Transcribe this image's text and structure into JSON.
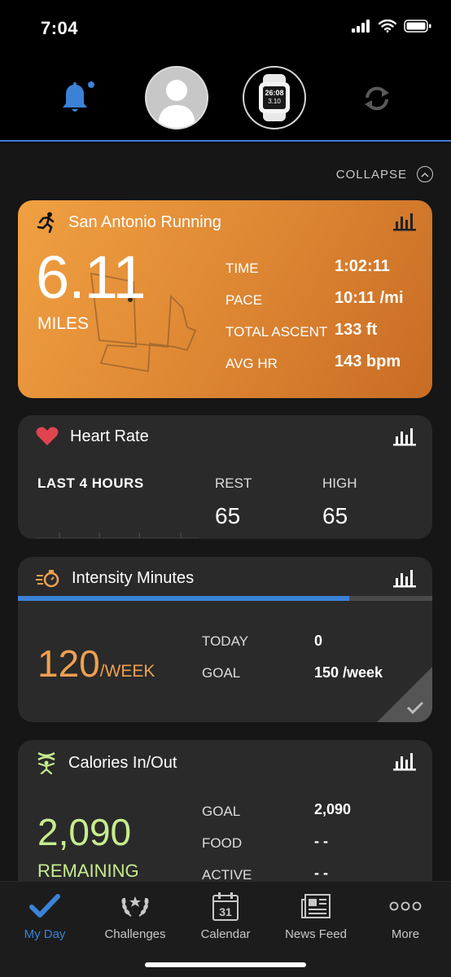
{
  "status_bar": {
    "time": "7:04"
  },
  "header": {
    "watch_face": {
      "line1": "26:08",
      "line2": "3.10"
    }
  },
  "collapse_label": "COLLAPSE",
  "activity_card": {
    "title": "San Antonio Running",
    "distance": "6.11",
    "distance_unit": "MILES",
    "stats": [
      {
        "label": "TIME",
        "value": "1:02:11"
      },
      {
        "label": "PACE",
        "value": "10:11 /mi"
      },
      {
        "label": "TOTAL ASCENT",
        "value": "133 ft"
      },
      {
        "label": "AVG HR",
        "value": "143 bpm"
      }
    ]
  },
  "heart_rate_card": {
    "title": "Heart Rate",
    "period": "LAST 4 HOURS",
    "rest_label": "REST",
    "rest_value": "65",
    "high_label": "HIGH",
    "high_value": "65"
  },
  "intensity_card": {
    "title": "Intensity Minutes",
    "progress_fraction": 0.8,
    "value": "120",
    "unit": "/WEEK",
    "rows": [
      {
        "label": "TODAY",
        "value": "0"
      },
      {
        "label": "GOAL",
        "value": "150 /week"
      }
    ]
  },
  "calories_card": {
    "title": "Calories In/Out",
    "value": "2,090",
    "unit": "REMAINING",
    "rows": [
      {
        "label": "GOAL",
        "value": "2,090"
      },
      {
        "label": "FOOD",
        "value": "- -"
      },
      {
        "label": "ACTIVE",
        "value": "- -"
      }
    ]
  },
  "tabs": [
    {
      "label": "My Day",
      "icon": "check-icon",
      "active": true
    },
    {
      "label": "Challenges",
      "icon": "laurel-icon",
      "active": false
    },
    {
      "label": "Calendar",
      "icon": "calendar-icon",
      "calendar_day": "31",
      "active": false
    },
    {
      "label": "News Feed",
      "icon": "newspaper-icon",
      "active": false
    },
    {
      "label": "More",
      "icon": "more-icon",
      "active": false
    }
  ],
  "colors": {
    "accent": "#3b82d6",
    "activity_gradient_start": "#f0a042",
    "activity_gradient_end": "#c86c24",
    "intensity": "#f0a050",
    "calories": "#c7ec8f",
    "heart": "#e0444e"
  }
}
